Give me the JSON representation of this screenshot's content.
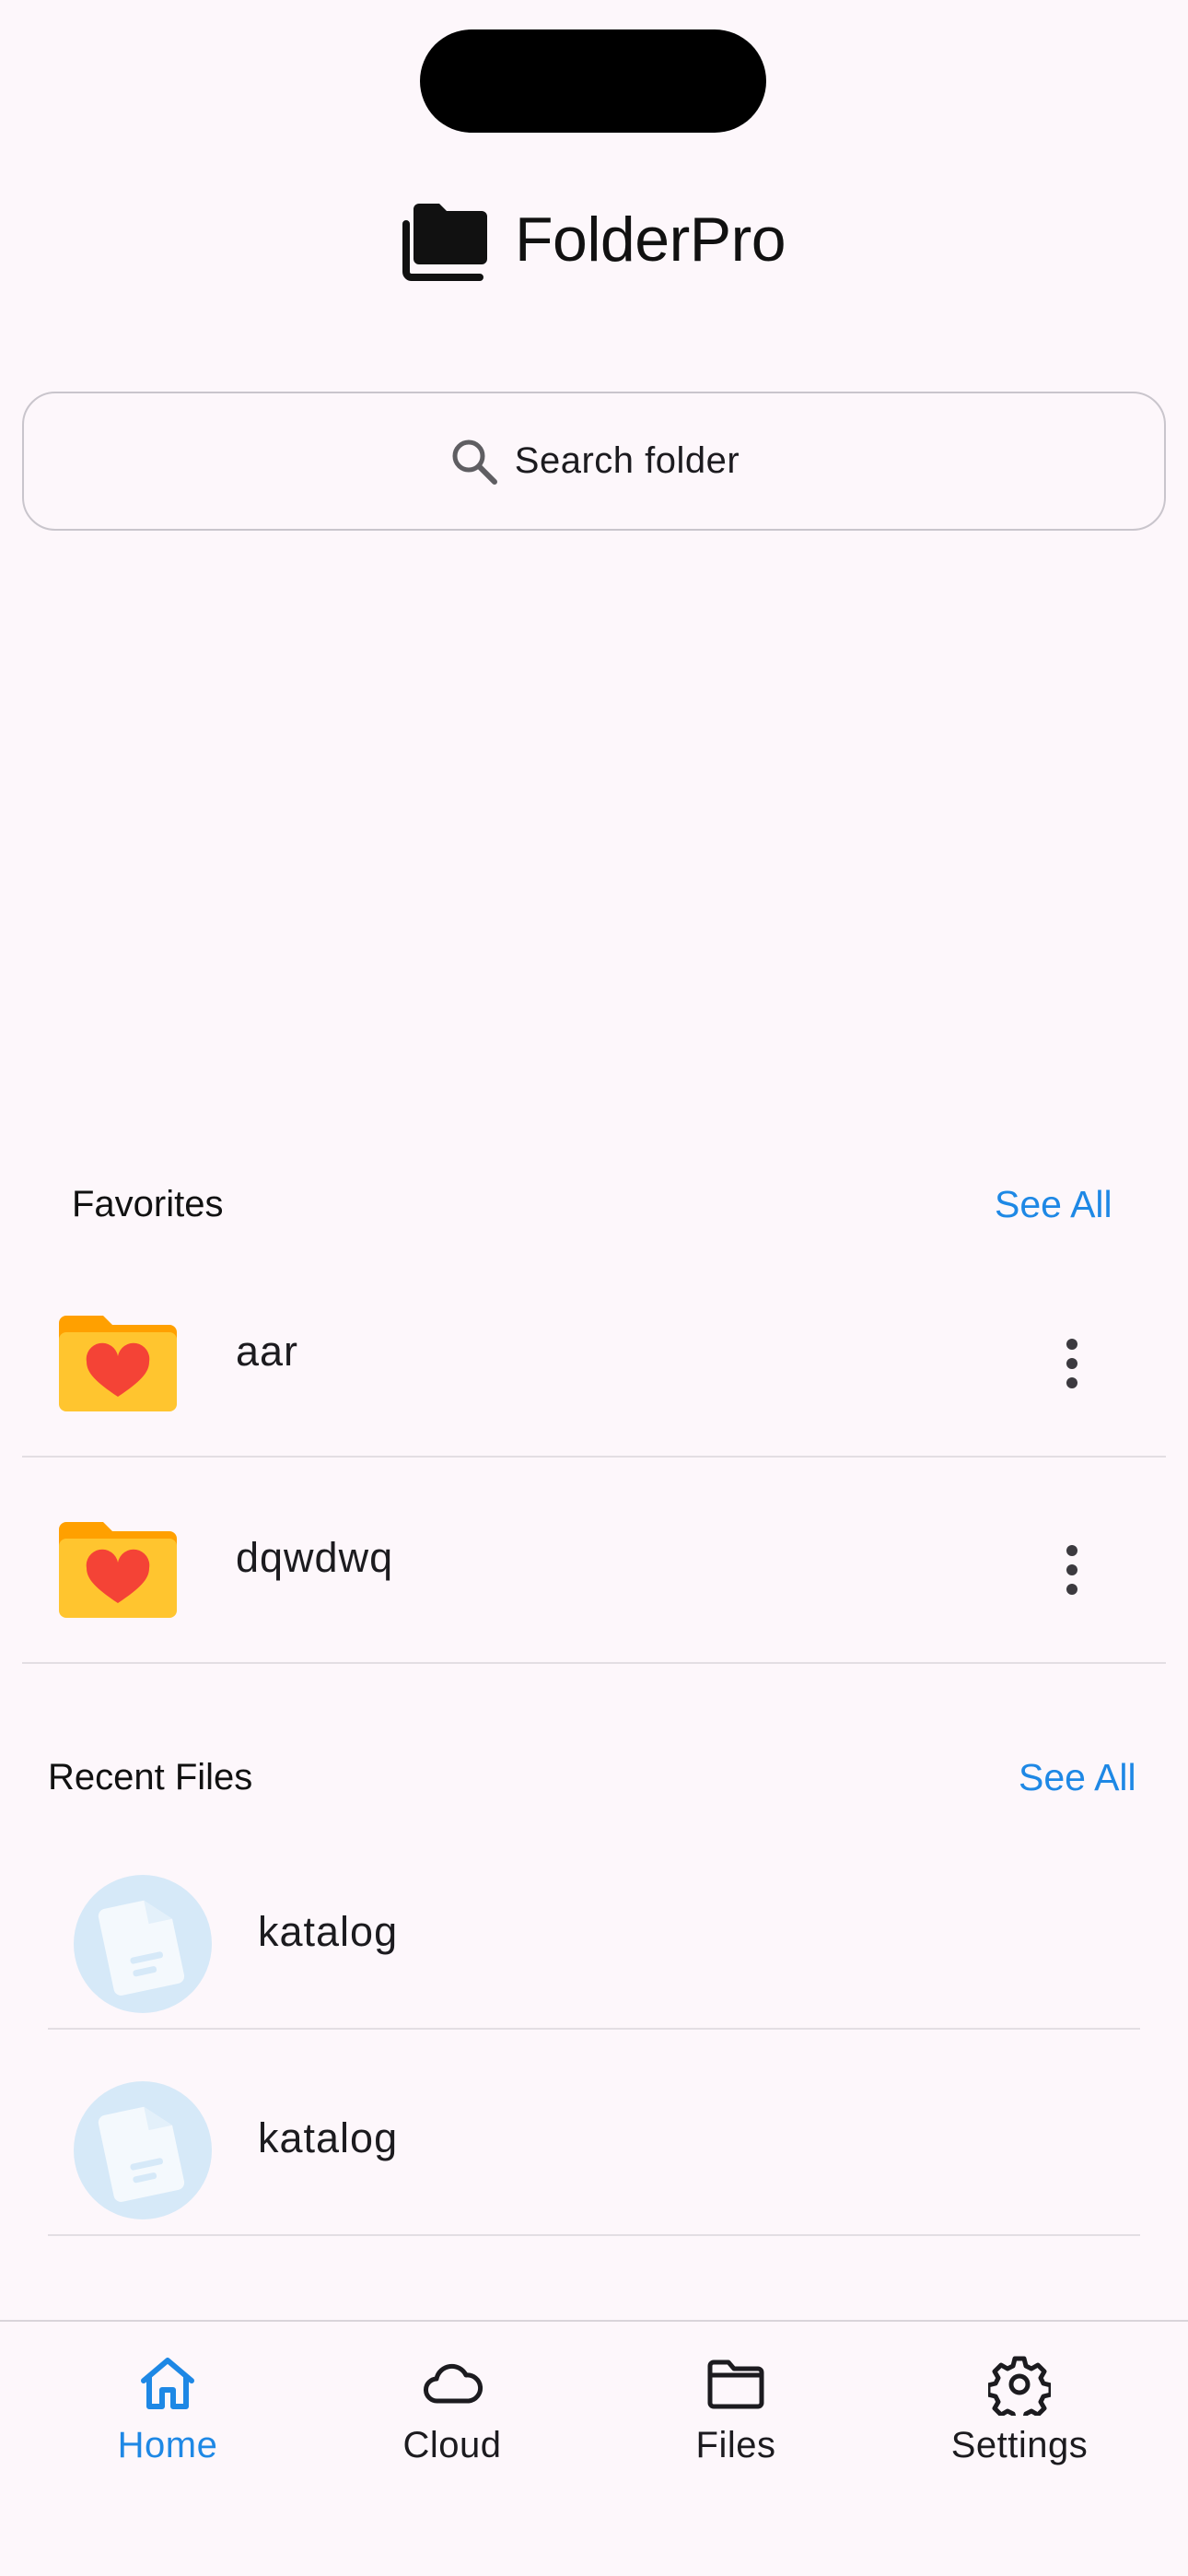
{
  "app": {
    "title": "FolderPro"
  },
  "search": {
    "placeholder": "Search folder"
  },
  "favorites": {
    "title": "Favorites",
    "see_all": "See All",
    "items": [
      {
        "name": "aar"
      },
      {
        "name": "dqwdwq"
      }
    ]
  },
  "recent": {
    "title": "Recent Files",
    "see_all": "See All",
    "items": [
      {
        "name": "katalog"
      },
      {
        "name": "katalog"
      }
    ]
  },
  "nav": {
    "items": [
      {
        "label": "Home",
        "icon": "home-icon",
        "active": true
      },
      {
        "label": "Cloud",
        "icon": "cloud-icon",
        "active": false
      },
      {
        "label": "Files",
        "icon": "folder-icon",
        "active": false
      },
      {
        "label": "Settings",
        "icon": "gear-icon",
        "active": false
      }
    ]
  },
  "colors": {
    "accent": "#1E88E5",
    "folder_yellow": "#FFC52F",
    "heart_red": "#F44336",
    "background": "#FDF7FB"
  }
}
